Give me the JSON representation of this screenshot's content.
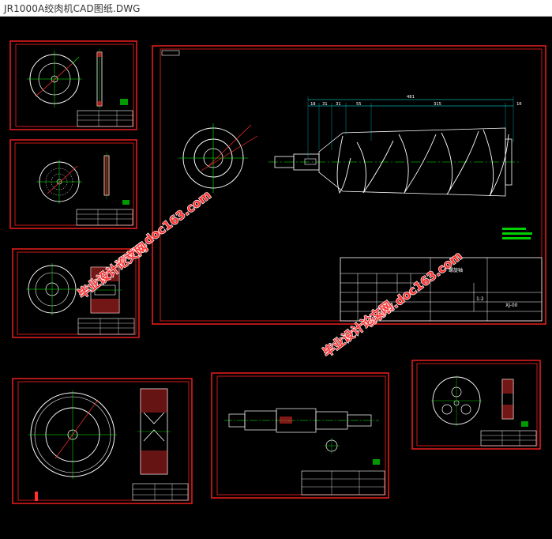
{
  "window": {
    "title": "JR1000A绞肉机CAD图纸.DWG"
  },
  "main_drawing": {
    "dimensions": {
      "total": "481",
      "d1": "18",
      "d2": "31",
      "d3": "31",
      "d4": "55",
      "d5": "315",
      "d6": "10"
    },
    "title_block": {
      "part_name": "螺旋轴",
      "drawing_no": "XJ-00",
      "scale": "1:2"
    }
  },
  "watermark": {
    "url": "www.doc163.com",
    "site": "毕业设计论文网"
  },
  "colors": {
    "frame": "#ff2020",
    "outline": "#ffffff",
    "center": "#00ff00",
    "hatch": "#ff3030",
    "dim": "#00ffff",
    "note": "#00d000"
  }
}
